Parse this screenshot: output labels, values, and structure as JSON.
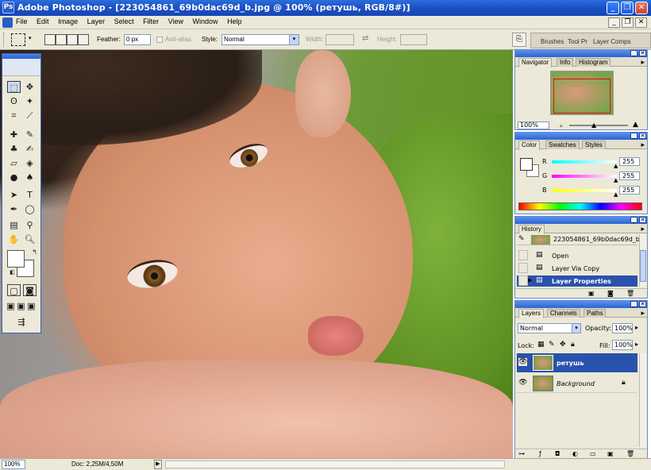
{
  "app": {
    "title": "Adobe Photoshop - [223054861_69b0dac69d_b.jpg @ 100% (ретушь, RGB/8#)]",
    "logo": "Ps"
  },
  "window_controls": {
    "minimize": "_",
    "restore": "❐",
    "close": "✕"
  },
  "doc_controls": {
    "minimize": "_",
    "restore": "❐",
    "close": "✕"
  },
  "menu": [
    "File",
    "Edit",
    "Image",
    "Layer",
    "Select",
    "Filter",
    "View",
    "Window",
    "Help"
  ],
  "options": {
    "feather_label": "Feather:",
    "feather_value": "0 px",
    "antialias_label": "Anti-alias",
    "style_label": "Style:",
    "style_value": "Normal",
    "width_label": "Width:",
    "width_value": "",
    "swap_icon": "⇄",
    "height_label": "Height:",
    "height_value": ""
  },
  "palette_well": [
    "Brushes",
    "Tool Pr",
    "Layer Comps"
  ],
  "navigator": {
    "tabs": [
      "Navigator",
      "Info",
      "Histogram"
    ],
    "zoom": "100%"
  },
  "color": {
    "tabs": [
      "Color",
      "Swatches",
      "Styles"
    ],
    "channels": [
      {
        "label": "R",
        "value": "255",
        "color": "#ff0000"
      },
      {
        "label": "G",
        "value": "255",
        "color": "#00ff00"
      },
      {
        "label": "B",
        "value": "255",
        "color": "#0000ff"
      }
    ]
  },
  "history": {
    "tabs": [
      "History"
    ],
    "snapshot": "223054861_69b0dac69d_b...",
    "steps": [
      "Open",
      "Layer Via Copy",
      "Layer Properties"
    ],
    "selected_index": 2
  },
  "layers": {
    "tabs": [
      "Layers",
      "Channels",
      "Paths"
    ],
    "blend_mode": "Normal",
    "opacity_label": "Opacity:",
    "opacity_value": "100%",
    "lock_label": "Lock:",
    "fill_label": "Fill:",
    "fill_value": "100%",
    "items": [
      {
        "name": "ретушь",
        "selected": true,
        "locked": false
      },
      {
        "name": "Background",
        "selected": false,
        "locked": true
      }
    ]
  },
  "status": {
    "zoom": "100%",
    "doc": "Doc: 2,25M/4,50M",
    "arrow": "▶"
  },
  "colors": {
    "title_blue": "#1c52c6",
    "selected_row": "#2952ad"
  }
}
